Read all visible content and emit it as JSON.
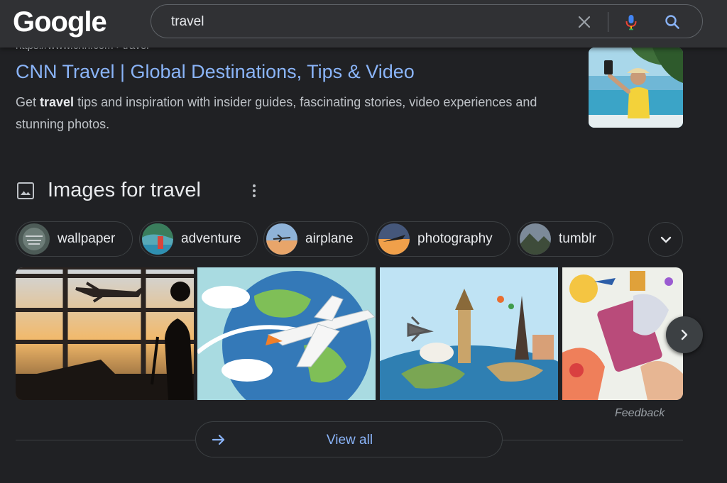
{
  "header": {
    "logo": "Google",
    "search": {
      "value": "travel"
    },
    "icons": {
      "clear": "close-icon",
      "voice": "mic-icon",
      "search": "search-icon"
    }
  },
  "result": {
    "cite": "https://www.cnn.com › travel",
    "title": "CNN Travel | Global Destinations, Tips & Video",
    "snippet_before": "Get ",
    "snippet_bold": "travel",
    "snippet_after": " tips and inspiration with insider guides, fascinating stories, video experiences and stunning photos."
  },
  "images_section": {
    "title": "Images for travel",
    "chips": [
      {
        "label": "wallpaper"
      },
      {
        "label": "adventure"
      },
      {
        "label": "airplane"
      },
      {
        "label": "photography"
      },
      {
        "label": "tumblr"
      }
    ],
    "feedback": "Feedback",
    "view_all": "View all"
  },
  "colors": {
    "background": "#202124",
    "header": "#303134",
    "link": "#8ab4f8",
    "text": "#bdc1c6"
  }
}
